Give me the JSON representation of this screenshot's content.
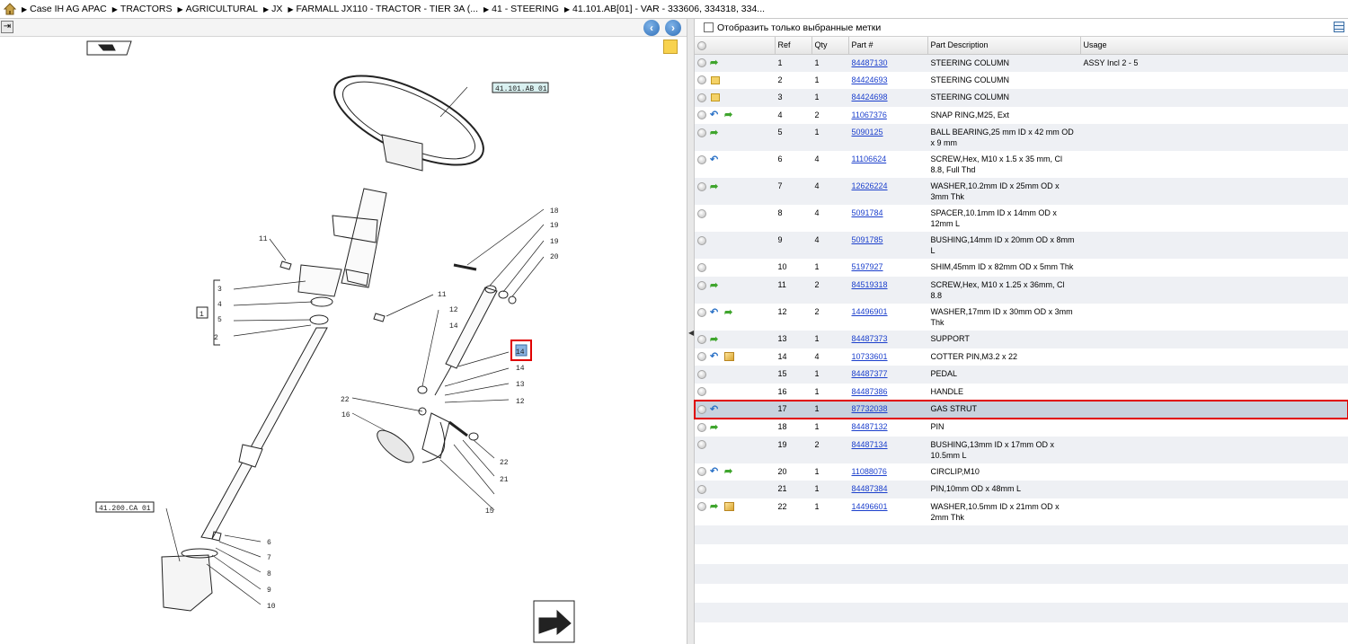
{
  "breadcrumb": [
    "Case IH AG APAC",
    "TRACTORS",
    "AGRICULTURAL",
    "JX",
    "FARMALL JX110 - TRACTOR - TIER 3A (...",
    "41 - STEERING",
    "41.101.AB[01] - VAR - 333606, 334318, 334..."
  ],
  "filter": {
    "label": "Отобразить только выбранные метки"
  },
  "columns": [
    "Ref",
    "Qty",
    "Part #",
    "Part Description",
    "Usage"
  ],
  "diagram": {
    "callout_wheel": "41.101.AB 01",
    "callout_bottom": "41.200.CA 01",
    "group_label": "1",
    "refs": [
      "1",
      "2",
      "3",
      "4",
      "5",
      "6",
      "7",
      "8",
      "9",
      "10",
      "11",
      "11",
      "12",
      "12",
      "13",
      "14",
      "14",
      "14",
      "15",
      "16",
      "17",
      "18",
      "19",
      "19",
      "20",
      "21",
      "22",
      "22"
    ]
  },
  "parts": [
    {
      "ref": "1",
      "qty": "1",
      "part": "84487130",
      "desc": "STEERING COLUMN",
      "usage": "ASSY Incl 2 - 5",
      "icons": [
        "green"
      ]
    },
    {
      "ref": "2",
      "qty": "1",
      "part": "84424693",
      "desc": "STEERING COLUMN",
      "usage": "",
      "icons": [
        "note"
      ]
    },
    {
      "ref": "3",
      "qty": "1",
      "part": "84424698",
      "desc": "STEERING COLUMN",
      "usage": "",
      "icons": [
        "note"
      ]
    },
    {
      "ref": "4",
      "qty": "2",
      "part": "11067376",
      "desc": "SNAP RING,M25, Ext",
      "usage": "",
      "icons": [
        "blue",
        "green"
      ]
    },
    {
      "ref": "5",
      "qty": "1",
      "part": "5090125",
      "desc": "BALL BEARING,25 mm ID x 42 mm OD x 9 mm",
      "usage": "",
      "icons": [
        "green"
      ]
    },
    {
      "ref": "6",
      "qty": "4",
      "part": "11106624",
      "desc": "SCREW,Hex, M10 x 1.5 x 35 mm, Cl 8.8, Full Thd",
      "usage": "",
      "icons": [
        "blue"
      ]
    },
    {
      "ref": "7",
      "qty": "4",
      "part": "12626224",
      "desc": "WASHER,10.2mm ID x 25mm OD x 3mm Thk",
      "usage": "",
      "icons": [
        "green"
      ]
    },
    {
      "ref": "8",
      "qty": "4",
      "part": "5091784",
      "desc": "SPACER,10.1mm ID x 14mm OD x 12mm L",
      "usage": "",
      "icons": []
    },
    {
      "ref": "9",
      "qty": "4",
      "part": "5091785",
      "desc": "BUSHING,14mm ID x 20mm OD x 8mm L",
      "usage": "",
      "icons": []
    },
    {
      "ref": "10",
      "qty": "1",
      "part": "5197927",
      "desc": "SHIM,45mm ID x 82mm OD x 5mm Thk",
      "usage": "",
      "icons": []
    },
    {
      "ref": "11",
      "qty": "2",
      "part": "84519318",
      "desc": "SCREW,Hex, M10 x 1.25 x 36mm, Cl 8.8",
      "usage": "",
      "icons": [
        "green"
      ]
    },
    {
      "ref": "12",
      "qty": "2",
      "part": "14496901",
      "desc": "WASHER,17mm ID x 30mm OD x 3mm Thk",
      "usage": "",
      "icons": [
        "blue",
        "green"
      ]
    },
    {
      "ref": "13",
      "qty": "1",
      "part": "84487373",
      "desc": "SUPPORT",
      "usage": "",
      "icons": [
        "green"
      ]
    },
    {
      "ref": "14",
      "qty": "4",
      "part": "10733601",
      "desc": "COTTER PIN,M3.2 x 22",
      "usage": "",
      "icons": [
        "blue",
        "box"
      ]
    },
    {
      "ref": "15",
      "qty": "1",
      "part": "84487377",
      "desc": "PEDAL",
      "usage": "",
      "icons": []
    },
    {
      "ref": "16",
      "qty": "1",
      "part": "84487386",
      "desc": "HANDLE",
      "usage": "",
      "icons": []
    },
    {
      "ref": "17",
      "qty": "1",
      "part": "87732038",
      "desc": "GAS STRUT",
      "usage": "",
      "icons": [
        "blue"
      ],
      "selected": true
    },
    {
      "ref": "18",
      "qty": "1",
      "part": "84487132",
      "desc": "PIN",
      "usage": "",
      "icons": [
        "green"
      ]
    },
    {
      "ref": "19",
      "qty": "2",
      "part": "84487134",
      "desc": "BUSHING,13mm ID x 17mm OD x 10.5mm L",
      "usage": "",
      "icons": []
    },
    {
      "ref": "20",
      "qty": "1",
      "part": "11088076",
      "desc": "CIRCLIP,M10",
      "usage": "",
      "icons": [
        "blue",
        "green"
      ]
    },
    {
      "ref": "21",
      "qty": "1",
      "part": "84487384",
      "desc": "PIN,10mm OD x 48mm L",
      "usage": "",
      "icons": []
    },
    {
      "ref": "22",
      "qty": "1",
      "part": "14496601",
      "desc": "WASHER,10.5mm ID x 21mm OD x 2mm Thk",
      "usage": "",
      "icons": [
        "green",
        "box"
      ]
    }
  ],
  "colors": {
    "selection_outline": "#e00000",
    "link": "#1b3fcc",
    "row_alt": "#eef0f4"
  }
}
